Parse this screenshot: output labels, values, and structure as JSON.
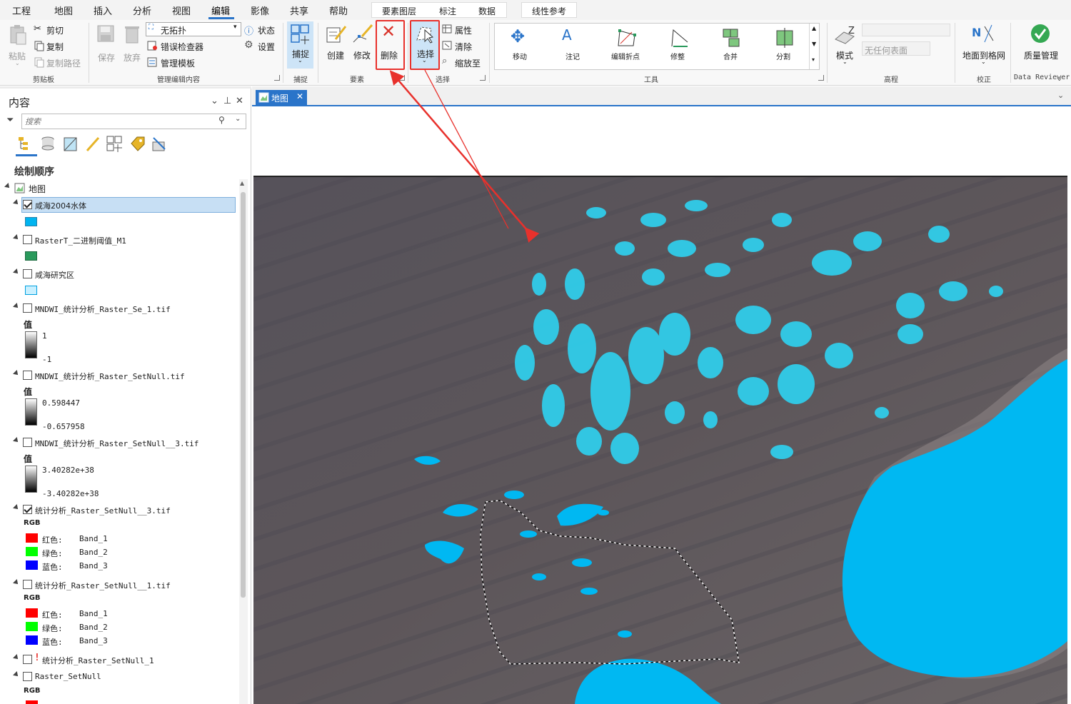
{
  "menubar": {
    "tabs": [
      "工程",
      "地图",
      "插入",
      "分析",
      "视图",
      "编辑",
      "影像",
      "共享",
      "帮助"
    ],
    "active_tab": "编辑",
    "context_tabs": [
      "要素图层",
      "标注",
      "数据"
    ],
    "extra_tab": "线性参考"
  },
  "ribbon": {
    "clipboard": {
      "paste": "粘贴",
      "cut": "剪切",
      "copy": "复制",
      "copy_path": "复制路径",
      "label": "剪贴板"
    },
    "manage": {
      "save": "保存",
      "discard": "放弃",
      "topology_value": "无拓扑",
      "status": "状态",
      "settings": "设置",
      "error_inspector": "错误检查器",
      "manage_templates": "管理模板",
      "label": "管理编辑内容"
    },
    "snapping": {
      "snap": "捕捉",
      "label": "捕捉"
    },
    "features": {
      "create": "创建",
      "modify": "修改",
      "delete": "删除",
      "label": "要素"
    },
    "selection": {
      "select": "选择",
      "attributes": "属性",
      "clear": "清除",
      "zoom_to": "缩放至",
      "label": "选择"
    },
    "tools": {
      "items": [
        "移动",
        "注记",
        "编辑折点",
        "修整",
        "合并",
        "分割"
      ],
      "label": "工具"
    },
    "elevation": {
      "mode": "模式",
      "surface_placeholder": "无任何表面",
      "label": "高程"
    },
    "correction": {
      "ground_to_grid": "地面到格网",
      "label": "校正"
    },
    "reviewer": {
      "quality": "质量管理",
      "label": "Data Reviewer"
    },
    "colors": {
      "highlight": "#e8312c",
      "accent": "#2a74c9",
      "select_bg": "#cde4f7"
    }
  },
  "contents": {
    "title": "内容",
    "search_placeholder": "搜索",
    "drawing_order": "绘制顺序",
    "map_node": "地图",
    "layers": [
      {
        "name": "咸海2004水体",
        "checked": true,
        "selected": true,
        "swatch": "#00b4f0"
      },
      {
        "name": "RasterT_二进制阈值_M1",
        "checked": false,
        "swatch": "#2a9a5c"
      },
      {
        "name": "咸海研究区",
        "checked": false,
        "swatch": "#c9f0ff"
      },
      {
        "name": "MNDWI_统计分析_Raster_Se_1.tif",
        "checked": false,
        "value_label": "值",
        "high": "1",
        "low": "-1"
      },
      {
        "name": "MNDWI_统计分析_Raster_SetNull.tif",
        "checked": false,
        "value_label": "值",
        "high": "0.598447",
        "low": "-0.657958"
      },
      {
        "name": "MNDWI_统计分析_Raster_SetNull__3.tif",
        "checked": false,
        "value_label": "值",
        "high": "3.40282e+38",
        "low": "-3.40282e+38"
      },
      {
        "name": "统计分析_Raster_SetNull__3.tif",
        "checked": true,
        "rgb": "RGB",
        "bands": [
          [
            "红色:",
            "Band_1"
          ],
          [
            "绿色:",
            "Band_2"
          ],
          [
            "蓝色:",
            "Band_3"
          ]
        ]
      },
      {
        "name": "统计分析_Raster_SetNull__1.tif",
        "checked": false,
        "rgb": "RGB",
        "bands": [
          [
            "红色:",
            "Band_1"
          ],
          [
            "绿色:",
            "Band_2"
          ],
          [
            "蓝色:",
            "Band_3"
          ]
        ]
      },
      {
        "name": "统计分析_Raster_SetNull_1",
        "checked": false,
        "warning": "!"
      },
      {
        "name": "Raster_SetNull",
        "checked": false,
        "rgb": "RGB"
      }
    ]
  },
  "map": {
    "tab_title": "地图",
    "colors": {
      "water": "#00b8f2",
      "land": "#5a5458"
    }
  }
}
